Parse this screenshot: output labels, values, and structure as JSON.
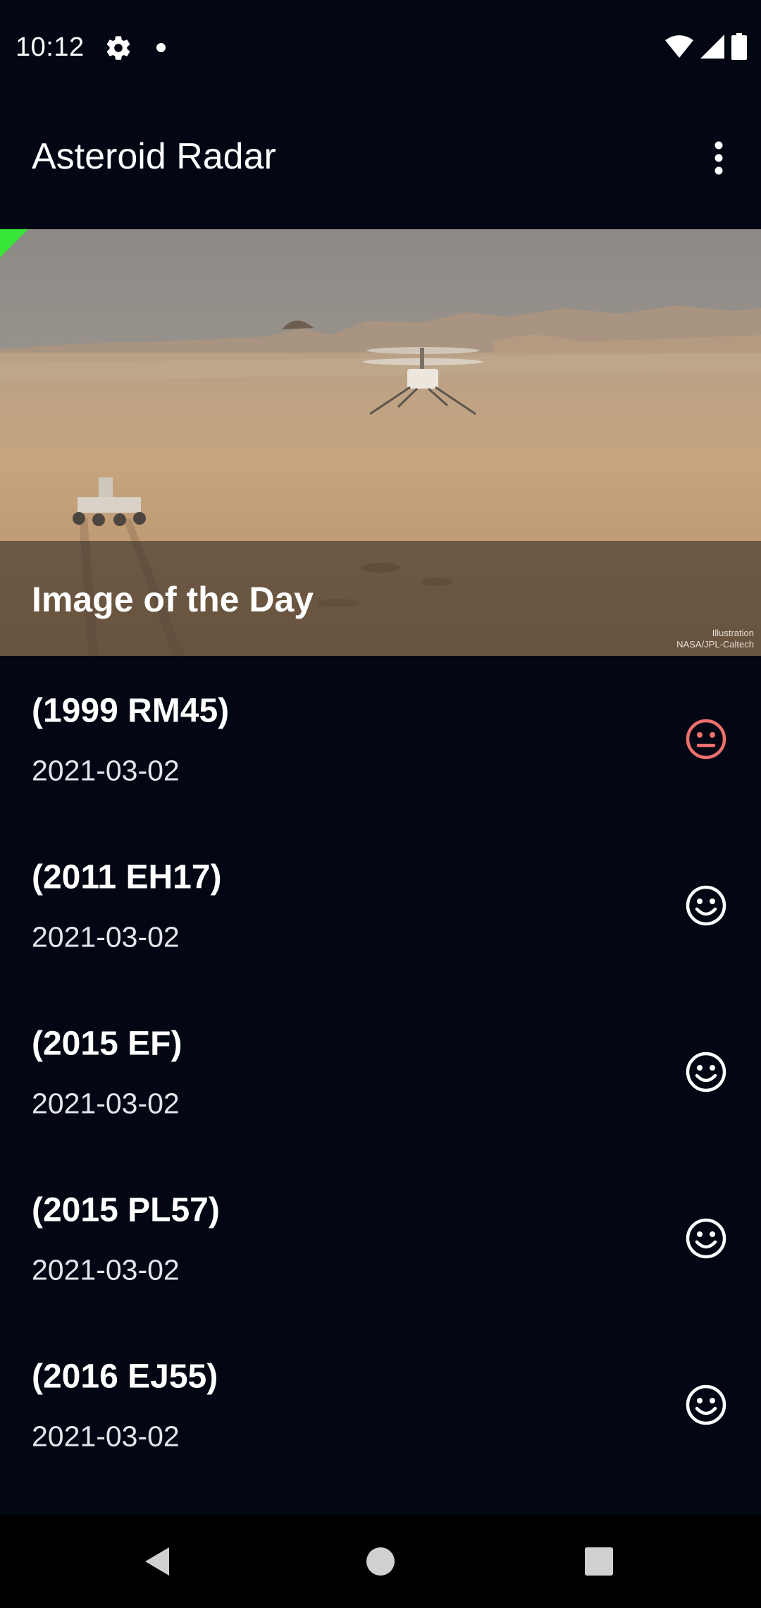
{
  "status_bar": {
    "time": "10:12",
    "icons": [
      "gear-icon",
      "notification-dot-icon",
      "wifi-icon",
      "signal-icon",
      "battery-icon"
    ]
  },
  "app_bar": {
    "title": "Asteroid Radar",
    "menu_icon": "more-vert-icon"
  },
  "image_of_day": {
    "title": "Image of the Day",
    "credit_line1": "Illustration",
    "credit_line2": "NASA/JPL-Caltech"
  },
  "asteroids": [
    {
      "name": "(1999 RM45)",
      "date": "2021-03-02",
      "hazardous": true,
      "icon": "sad-face-icon",
      "icon_color": "#f0706d"
    },
    {
      "name": "(2011 EH17)",
      "date": "2021-03-02",
      "hazardous": false,
      "icon": "happy-face-icon",
      "icon_color": "#ffffff"
    },
    {
      "name": "(2015 EF)",
      "date": "2021-03-02",
      "hazardous": false,
      "icon": "happy-face-icon",
      "icon_color": "#ffffff"
    },
    {
      "name": "(2015 PL57)",
      "date": "2021-03-02",
      "hazardous": false,
      "icon": "happy-face-icon",
      "icon_color": "#ffffff"
    },
    {
      "name": "(2016 EJ55)",
      "date": "2021-03-02",
      "hazardous": false,
      "icon": "happy-face-icon",
      "icon_color": "#ffffff"
    }
  ],
  "colors": {
    "background": "#030713",
    "hazard": "#f0706d",
    "safe": "#ffffff"
  },
  "nav_bar": {
    "back_icon": "back-triangle-icon",
    "home_icon": "home-circle-icon",
    "recents_icon": "recents-square-icon"
  }
}
